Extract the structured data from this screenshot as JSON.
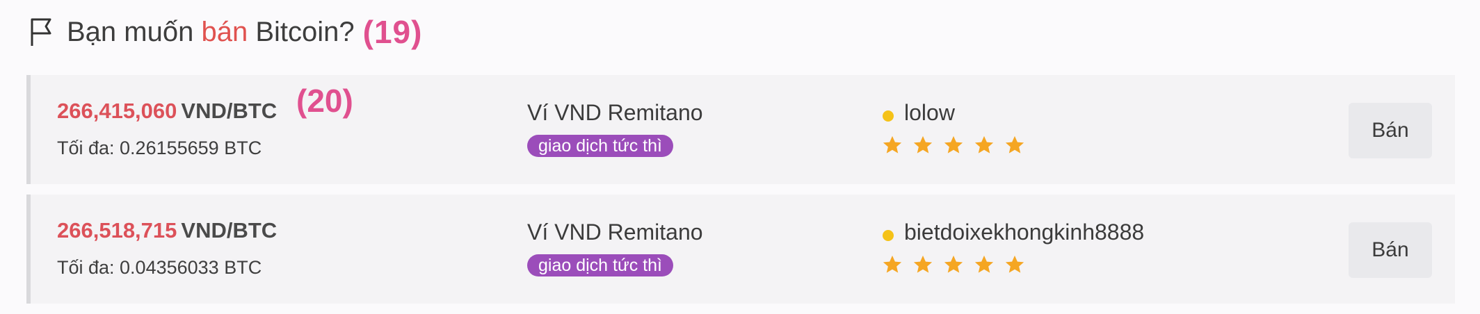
{
  "header": {
    "title_prefix": "Bạn muốn ",
    "title_highlight": "bán",
    "title_suffix": " Bitcoin?",
    "badge": "(19)",
    "icon": "flag-icon"
  },
  "offers": [
    {
      "price": "266,415,060",
      "unit": "VND/BTC",
      "annotation": "(20)",
      "max_label": "Tối đa: 0.26155659 BTC",
      "wallet": "Ví VND Remitano",
      "tag": "giao dịch tức thì",
      "username": "lolow",
      "rating_stars": 5,
      "button": "Bán"
    },
    {
      "price": "266,518,715",
      "unit": "VND/BTC",
      "max_label": "Tối đa: 0.04356033 BTC",
      "wallet": "Ví VND Remitano",
      "tag": "giao dịch tức thì",
      "username": "bietdoixekhongkinh8888",
      "rating_stars": 5,
      "button": "Bán"
    }
  ],
  "colors": {
    "price": "#dc5159",
    "highlight": "#e0524f",
    "badge": "#e0508f",
    "tag_bg": "#9b4dba",
    "online_dot": "#f5c218",
    "star": "#f5a623"
  }
}
